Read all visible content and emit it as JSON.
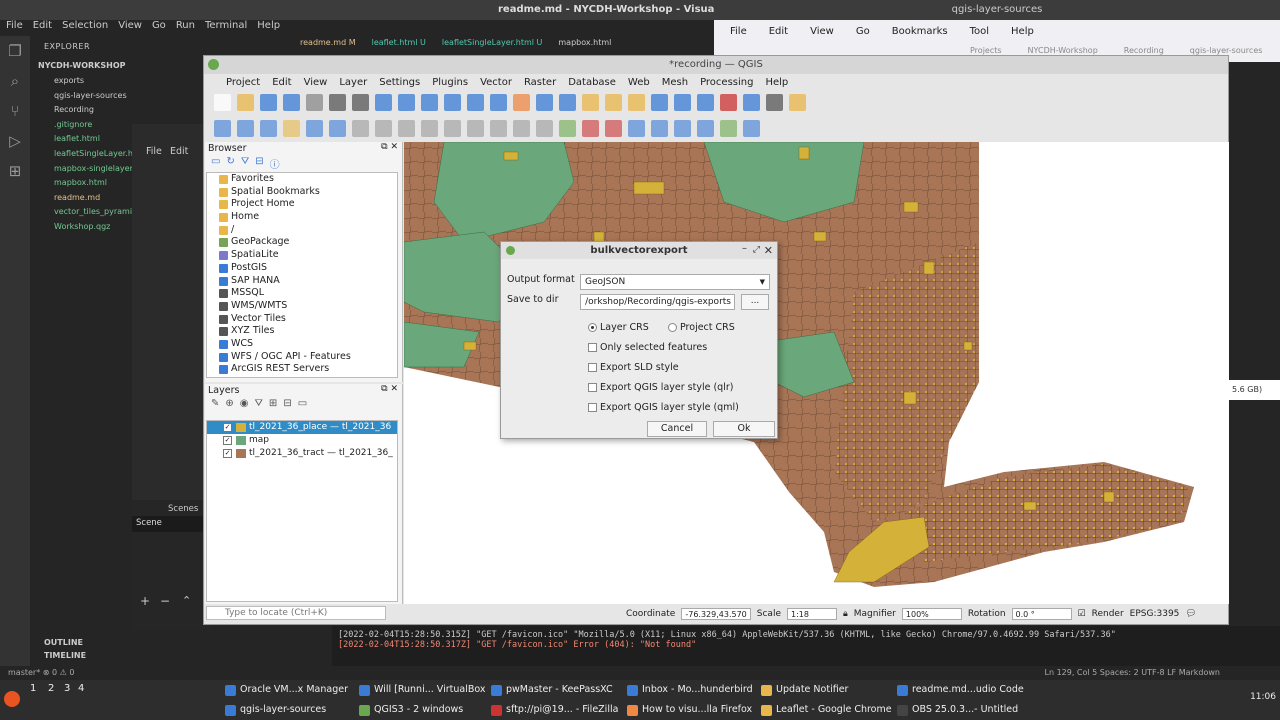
{
  "vscode": {
    "title": "readme.md - NYCDH-Workshop - Visual",
    "menu": [
      "File",
      "Edit",
      "Selection",
      "View",
      "Go",
      "Run",
      "Terminal",
      "Help"
    ],
    "explorer_title": "EXPLORER",
    "workspace": "NYCDH-WORKSHOP",
    "files": [
      {
        "name": "exports",
        "kind": "folder"
      },
      {
        "name": "qgis-layer-sources",
        "kind": "folder"
      },
      {
        "name": "Recording",
        "kind": "folder"
      },
      {
        "name": ".gitignore",
        "kind": "git"
      },
      {
        "name": "leaflet.html",
        "kind": "git"
      },
      {
        "name": "leafletSingleLayer.ht",
        "kind": "git"
      },
      {
        "name": "mapbox-singlelayer.h",
        "kind": "git"
      },
      {
        "name": "mapbox.html",
        "kind": "git"
      },
      {
        "name": "readme.md",
        "kind": "mod"
      },
      {
        "name": "vector_tiles_pyramid",
        "kind": "git"
      },
      {
        "name": "Workshop.qgz",
        "kind": "git"
      }
    ],
    "tabs": [
      "readme.md M",
      "leaflet.html U",
      "leafletSingleLayer.html U",
      "mapbox.html"
    ],
    "outline": "OUTLINE",
    "timeline": "TIMELINE",
    "status_left": "master*  ⊗ 0 ⚠ 0",
    "status_right": "Ln 129, Col 5   Spaces: 2   UTF-8   LF   Markdown",
    "terminal_lines": [
      "[2022-02-04T15:28:50.315Z]  \"GET /favicon.ico\" \"Mozilla/5.0 (X11; Linux x86_64) AppleWebKit/537.36 (KHTML, like Gecko) Chrome/97.0.4692.99 Safari/537.36\"",
      "[2022-02-04T15:28:50.317Z]  \"GET /favicon.ico\" Error (404): \"Not found\""
    ]
  },
  "firefox": {
    "title": "qgis-layer-sources",
    "menu": [
      "File",
      "Edit",
      "View",
      "Go",
      "Bookmarks",
      "Tool",
      "Help"
    ],
    "tabs": [
      "Projects",
      "NYCDH-Workshop",
      "Recording",
      "qgis-layer-sources"
    ]
  },
  "darkwin": {
    "file": "File",
    "edit": "Edit",
    "scenes_title": "Scenes",
    "scene_item": "Scene"
  },
  "qgis": {
    "title": "*recording — QGIS",
    "menu": [
      "Project",
      "Edit",
      "View",
      "Layer",
      "Settings",
      "Plugins",
      "Vector",
      "Raster",
      "Database",
      "Web",
      "Mesh",
      "Processing",
      "Help"
    ],
    "browser": {
      "title": "Browser",
      "items": [
        "Favorites",
        "Spatial Bookmarks",
        "Project Home",
        "Home",
        "/",
        "GeoPackage",
        "SpatiaLite",
        "PostGIS",
        "SAP HANA",
        "MSSQL",
        "WMS/WMTS",
        "Vector Tiles",
        "XYZ Tiles",
        "WCS",
        "WFS / OGC API - Features",
        "ArcGIS REST Servers"
      ]
    },
    "layers": {
      "title": "Layers",
      "items": [
        {
          "name": "tl_2021_36_place — tl_2021_36",
          "color": "#d4b23a",
          "selected": true
        },
        {
          "name": "map",
          "color": "#6aa77a",
          "selected": false
        },
        {
          "name": "tl_2021_36_tract — tl_2021_36_",
          "color": "#a87556",
          "selected": false
        }
      ]
    },
    "locator_placeholder": "Type to locate (Ctrl+K)",
    "status": {
      "coord_label": "Coordinate",
      "coord_value": "-76.329,43.570",
      "scale_label": "Scale",
      "scale_value": "1:18",
      "magnifier_label": "Magnifier",
      "magnifier_value": "100%",
      "rotation_label": "Rotation",
      "rotation_value": "0.0 °",
      "render_label": "Render",
      "epsg": "EPSG:3395"
    },
    "right_fragment": "5.6 GB)",
    "colors": {
      "land": "#a87556",
      "place": "#d4b23a",
      "green": "#6aa77a",
      "water": "#ffffff"
    }
  },
  "dialog": {
    "title": "bulkvectorexport",
    "output_format_label": "Output format",
    "output_format_value": "GeoJSON",
    "save_dir_label": "Save to dir",
    "save_dir_value": "/orkshop/Recording/qgis-exports",
    "browse_label": "...",
    "crs_options": [
      {
        "label": "Layer CRS",
        "checked": true
      },
      {
        "label": "Project CRS",
        "checked": false
      }
    ],
    "checkboxes": [
      "Only selected features",
      "Export SLD style",
      "Export QGIS layer style (qlr)",
      "Export QGIS layer style (qml)"
    ],
    "cancel_label": "Cancel",
    "ok_label": "Ok"
  },
  "taskbar": {
    "workspaces": [
      "1",
      "2",
      "3",
      "4"
    ],
    "tasks_row1": [
      "Oracle VM...x Manager",
      "Will [Runni... VirtualBox",
      "pwMaster - KeePassXC",
      "Inbox - Mo...hunderbird",
      "Update Notifier",
      "readme.md...udio Code"
    ],
    "tasks_row2": [
      "qgis-layer-sources",
      "QGIS3 - 2 windows",
      "sftp://pi@19... - FileZilla",
      "How to visu...lla Firefox",
      "Leaflet - Google Chrome",
      "OBS 25.0.3...- Untitled"
    ],
    "clock": "11:06"
  }
}
